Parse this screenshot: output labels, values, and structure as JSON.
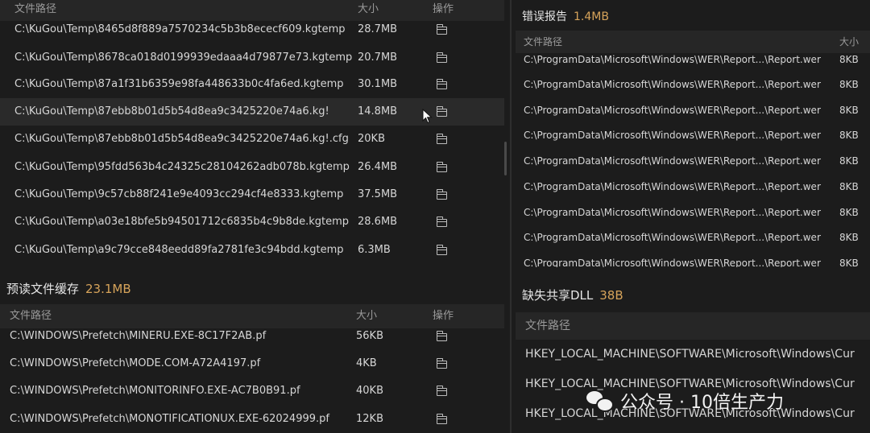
{
  "kugou_panel": {
    "header": {
      "path": "文件路径",
      "size": "大小",
      "action": "操作"
    },
    "rows": [
      {
        "path": "C:\\KuGou\\Temp\\8465d8f889a7570234c5b3b8ececf609.kgtemp",
        "size": "28.7MB"
      },
      {
        "path": "C:\\KuGou\\Temp\\8678ca018d0199939edaaa4d79877e73.kgtemp",
        "size": "20.7MB"
      },
      {
        "path": "C:\\KuGou\\Temp\\87a1f31b6359e98fa448633b0c4fa6ed.kgtemp",
        "size": "30.1MB"
      },
      {
        "path": "C:\\KuGou\\Temp\\87ebb8b01d5b54d8ea9c3425220e74a6.kg!",
        "size": "14.8MB"
      },
      {
        "path": "C:\\KuGou\\Temp\\87ebb8b01d5b54d8ea9c3425220e74a6.kg!.cfg",
        "size": "20KB"
      },
      {
        "path": "C:\\KuGou\\Temp\\95fdd563b4c24325c28104262adb078b.kgtemp",
        "size": "26.4MB"
      },
      {
        "path": "C:\\KuGou\\Temp\\9c57cb88f241e9e4093cc294cf4e8333.kgtemp",
        "size": "37.5MB"
      },
      {
        "path": "C:\\KuGou\\Temp\\a03e18bfe5b94501712c6835b4c9b8de.kgtemp",
        "size": "28.6MB"
      },
      {
        "path": "C:\\KuGou\\Temp\\a9c79cce848eedd89fa2781fe3c94bdd.kgtemp",
        "size": "6.3MB"
      }
    ]
  },
  "prefetch_panel": {
    "title": "预读文件缓存",
    "total": "23.1MB",
    "header": {
      "path": "文件路径",
      "size": "大小",
      "action": "操作"
    },
    "rows": [
      {
        "path": "C:\\WINDOWS\\Prefetch\\MINERU.EXE-8C17F2AB.pf",
        "size": "56KB"
      },
      {
        "path": "C:\\WINDOWS\\Prefetch\\MODE.COM-A72A4197.pf",
        "size": "4KB"
      },
      {
        "path": "C:\\WINDOWS\\Prefetch\\MONITORINFO.EXE-AC7B0B91.pf",
        "size": "40KB"
      },
      {
        "path": "C:\\WINDOWS\\Prefetch\\MONOTIFICATIONUX.EXE-62024999.pf",
        "size": "12KB"
      }
    ]
  },
  "error_report_panel": {
    "title": "错误报告",
    "total": "1.4MB",
    "header": {
      "path": "文件路径",
      "size": "大小"
    },
    "rows": [
      {
        "path": "C:\\ProgramData\\Microsoft\\Windows\\WER\\Report...\\Report.wer",
        "size": "8KB"
      },
      {
        "path": "C:\\ProgramData\\Microsoft\\Windows\\WER\\Report...\\Report.wer",
        "size": "8KB"
      },
      {
        "path": "C:\\ProgramData\\Microsoft\\Windows\\WER\\Report...\\Report.wer",
        "size": "8KB"
      },
      {
        "path": "C:\\ProgramData\\Microsoft\\Windows\\WER\\Report...\\Report.wer",
        "size": "8KB"
      },
      {
        "path": "C:\\ProgramData\\Microsoft\\Windows\\WER\\Report...\\Report.wer",
        "size": "8KB"
      },
      {
        "path": "C:\\ProgramData\\Microsoft\\Windows\\WER\\Report...\\Report.wer",
        "size": "8KB"
      },
      {
        "path": "C:\\ProgramData\\Microsoft\\Windows\\WER\\Report...\\Report.wer",
        "size": "8KB"
      },
      {
        "path": "C:\\ProgramData\\Microsoft\\Windows\\WER\\Report...\\Report.wer",
        "size": "8KB"
      },
      {
        "path": "C:\\ProgramData\\Microsoft\\Windows\\WER\\Report...\\Report.wer",
        "size": "8KB"
      }
    ]
  },
  "dll_panel": {
    "title": "缺失共享DLL",
    "total": "38B",
    "header": {
      "path": "文件路径"
    },
    "rows": [
      {
        "path": "HKEY_LOCAL_MACHINE\\SOFTWARE\\Microsoft\\Windows\\Cur"
      },
      {
        "path": "HKEY_LOCAL_MACHINE\\SOFTWARE\\Microsoft\\Windows\\Cur"
      },
      {
        "path": "HKEY_LOCAL_MACHINE\\SOFTWARE\\Microsoft\\Windows\\Cur"
      }
    ]
  },
  "watermark": {
    "text": "公众号 · 10倍生产力"
  }
}
